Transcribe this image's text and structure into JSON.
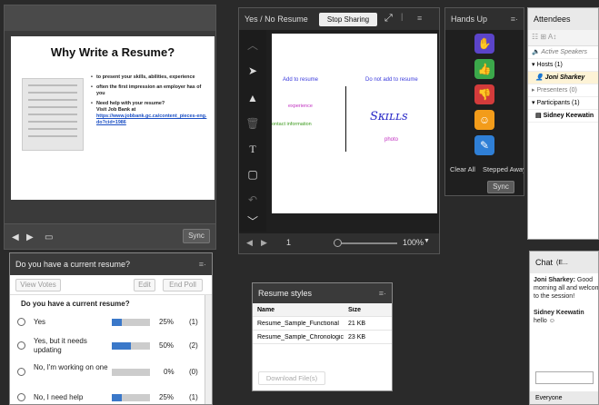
{
  "slide": {
    "title": "Why Write a Resume?",
    "bullets": [
      "to present your skills, abilities, experience",
      "often the first impression an employer has of you"
    ],
    "need_help": "Need help with your resume?",
    "visit": "Visit Job Bank at",
    "link": "https://www.jobbank.gc.ca/content_pieces-eng.do?cid=1986",
    "sync_label": "Sync"
  },
  "whiteboard": {
    "title": "Yes / No Resume",
    "stop_sharing_label": "Stop Sharing",
    "add_label": "Add to resume",
    "no_add_label": "Do not add to resume",
    "experience": "experience",
    "contact": "ontact information",
    "skills": "Sᴋɪʟʟs",
    "photo": "photo",
    "page_number": "1",
    "zoom": "100%"
  },
  "hands_up": {
    "title": "Hands Up",
    "clear_all_label": "Clear All",
    "stepped_away_label": "Stepped Away",
    "sync_label": "Sync",
    "colors": {
      "hand": "#5b44c9",
      "thumb_up": "#3ba84a",
      "thumb_down": "#d33b3b",
      "smile": "#f39c1a",
      "applause": "#2f7fd6"
    }
  },
  "attendees": {
    "title": "Attendees",
    "active_speakers": "Active Speakers",
    "hosts": "Hosts (1)",
    "host_name": "Joni Sharkey",
    "presenters": "Presenters (0)",
    "participants": "Participants (1)",
    "participant_name": "Sidney Keewatin"
  },
  "poll": {
    "title": "Do you have a current resume?",
    "view_votes_label": "View Votes",
    "edit_label": "Edit",
    "end_poll_label": "End Poll",
    "question": "Do you have a current resume?",
    "answers": [
      {
        "text": "Yes",
        "percent": "25%",
        "count": "(1)",
        "fraction": 0.25
      },
      {
        "text": "Yes, but it needs updating",
        "percent": "50%",
        "count": "(2)",
        "fraction": 0.5
      },
      {
        "text": "No, I'm working on one",
        "percent": "0%",
        "count": "(0)",
        "fraction": 0
      },
      {
        "text": "No, I need help",
        "percent": "25%",
        "count": "(1)",
        "fraction": 0.25
      }
    ]
  },
  "files": {
    "title": "Resume styles",
    "col_name": "Name",
    "col_size": "Size",
    "rows": [
      {
        "name": "Resume_Sample_Functional",
        "size": "21 KB"
      },
      {
        "name": "Resume_Sample_Chronological",
        "size": "23 KB"
      }
    ],
    "download_label": "Download File(s)"
  },
  "chat": {
    "title": "Chat",
    "tab_label": "(E...",
    "message1_sender": "Joni Sharkey:",
    "message1_text": "Good morning all and welcome to the session!",
    "message2_sender": "Sidney Keewatin",
    "message2_text": "hello ☺",
    "recipient": "Everyone"
  }
}
